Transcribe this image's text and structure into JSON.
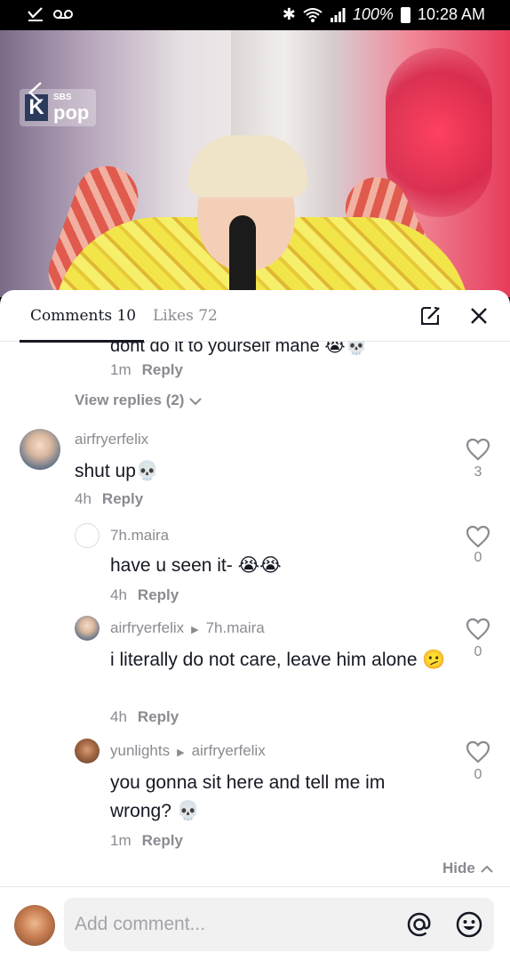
{
  "status_bar": {
    "battery": "100%",
    "time": "10:28 AM"
  },
  "video": {
    "logo_small": "SBS",
    "logo_big": "pop",
    "logo_k": "K"
  },
  "tabs": {
    "comments": "Comments 10",
    "likes": "Likes 72"
  },
  "thread": {
    "cut_text": "dont do it to yourself mane 😭💀",
    "cut_meta_time": "1m",
    "reply_label": "Reply",
    "view_replies": "View replies (2)"
  },
  "comments": [
    {
      "username": "airfryerfelix",
      "text": "shut up💀",
      "time": "4h",
      "likes": "3"
    },
    {
      "username": "7h.maira",
      "text": "have u seen it- 😭😭",
      "time": "4h",
      "likes": "0"
    },
    {
      "username": "airfryerfelix",
      "reply_to": "7h.maira",
      "text": "i literally do not care, leave him alone 🫤",
      "time": "4h",
      "likes": "0"
    },
    {
      "username": "yunlights",
      "reply_to": "airfryerfelix",
      "text": "you gonna sit here and tell me im wrong? 💀",
      "time": "1m",
      "likes": "0"
    }
  ],
  "hide_label": "Hide",
  "input": {
    "placeholder": "Add comment..."
  },
  "colors": {
    "text": "#161823",
    "muted": "#8a8b91",
    "input_bg": "#f1f1f2"
  }
}
